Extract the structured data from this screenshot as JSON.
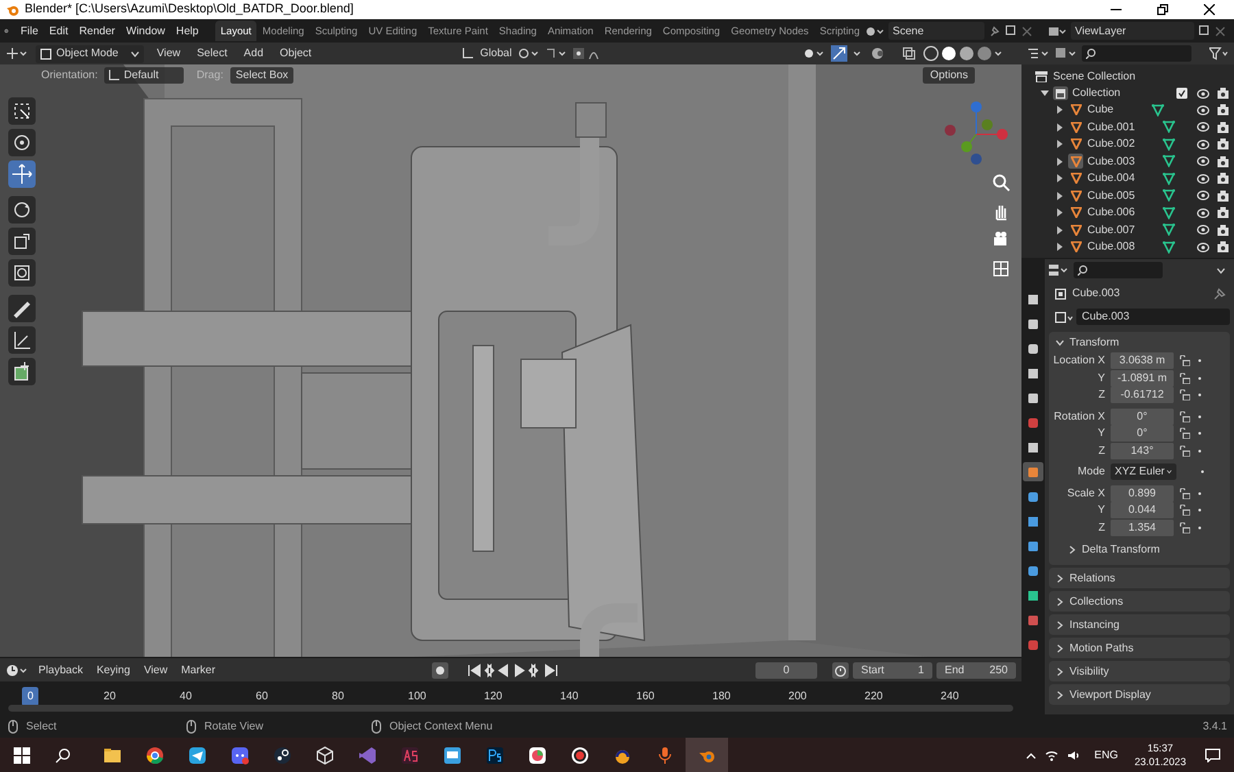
{
  "window": {
    "title": "Blender* [C:\\Users\\Azumi\\Desktop\\Old_BATDR_Door.blend]"
  },
  "menu": [
    "File",
    "Edit",
    "Render",
    "Window",
    "Help"
  ],
  "workspaces": [
    {
      "label": "Layout",
      "selected": true
    },
    {
      "label": "Modeling",
      "selected": false
    },
    {
      "label": "Sculpting",
      "selected": false
    },
    {
      "label": "UV Editing",
      "selected": false
    },
    {
      "label": "Texture Paint",
      "selected": false
    },
    {
      "label": "Shading",
      "selected": false
    },
    {
      "label": "Animation",
      "selected": false
    },
    {
      "label": "Rendering",
      "selected": false
    },
    {
      "label": "Compositing",
      "selected": false
    },
    {
      "label": "Geometry Nodes",
      "selected": false
    },
    {
      "label": "Scripting",
      "selected": false
    }
  ],
  "scene": "Scene",
  "view_layer": "ViewLayer",
  "viewport_header": {
    "mode": "Object Mode",
    "menus": [
      "View",
      "Select",
      "Add",
      "Object"
    ],
    "transform": "Global"
  },
  "tool_settings": {
    "orientation_label": "Orientation:",
    "orientation": "Default",
    "drag_label": "Drag:",
    "drag": "Select Box",
    "options": "Options"
  },
  "tools": [
    {
      "selected": false
    },
    {
      "selected": false
    },
    {
      "selected": true
    },
    {
      "selected": false
    },
    {
      "selected": false
    },
    {
      "selected": false
    },
    {
      "selected": false
    },
    {
      "selected": false
    },
    {
      "selected": false
    }
  ],
  "outliner": {
    "root": "Scene Collection",
    "collection": {
      "name": "Collection",
      "expanded": true,
      "checked": true,
      "children": [
        {
          "name": "Cube",
          "selected": false
        },
        {
          "name": "Cube.001",
          "selected": false
        },
        {
          "name": "Cube.002",
          "selected": false
        },
        {
          "name": "Cube.003",
          "selected": true
        },
        {
          "name": "Cube.004",
          "selected": false
        },
        {
          "name": "Cube.005",
          "selected": false
        },
        {
          "name": "Cube.006",
          "selected": false
        },
        {
          "name": "Cube.007",
          "selected": false
        },
        {
          "name": "Cube.008",
          "selected": false
        }
      ]
    }
  },
  "properties": {
    "object": "Cube.003",
    "object_field": "Cube.003",
    "tabs": [
      {
        "selected": false
      },
      {
        "selected": false
      },
      {
        "selected": false
      },
      {
        "selected": false
      },
      {
        "selected": false
      },
      {
        "selected": false
      },
      {
        "selected": false
      },
      {
        "selected": true
      },
      {
        "selected": false
      },
      {
        "selected": false
      },
      {
        "selected": false
      },
      {
        "selected": false
      },
      {
        "selected": false
      },
      {
        "selected": false
      },
      {
        "selected": false
      }
    ],
    "transform": {
      "title": "Transform",
      "expanded": true,
      "rows": [
        {
          "label": "Location X",
          "value": "3.0638 m"
        },
        {
          "label": "Y",
          "value": "-1.0891 m"
        },
        {
          "label": "Z",
          "value": "-0.61712"
        },
        {
          "label": "Rotation X",
          "value": "0°"
        },
        {
          "label": "Y",
          "value": "0°"
        },
        {
          "label": "Z",
          "value": "143°"
        },
        {
          "label": "Mode",
          "value": "XYZ Euler",
          "kind": "dropdown"
        },
        {
          "label": "Scale X",
          "value": "0.899"
        },
        {
          "label": "Y",
          "value": "0.044"
        },
        {
          "label": "Z",
          "value": "1.354"
        }
      ],
      "subpanel": "Delta Transform"
    },
    "panels": [
      "Relations",
      "Collections",
      "Instancing",
      "Motion Paths",
      "Visibility",
      "Viewport Display"
    ]
  },
  "timeline": {
    "menus": [
      "Playback",
      "Keying",
      "View",
      "Marker"
    ],
    "current_frame": "0",
    "start_label": "Start",
    "start": "1",
    "end_label": "End",
    "end": "250",
    "ticks": [
      {
        "label": "0",
        "selected": true
      },
      {
        "label": "20",
        "selected": false
      },
      {
        "label": "40",
        "selected": false
      },
      {
        "label": "60",
        "selected": false
      },
      {
        "label": "80",
        "selected": false
      },
      {
        "label": "100",
        "selected": false
      },
      {
        "label": "120",
        "selected": false
      },
      {
        "label": "140",
        "selected": false
      },
      {
        "label": "160",
        "selected": false
      },
      {
        "label": "180",
        "selected": false
      },
      {
        "label": "200",
        "selected": false
      },
      {
        "label": "220",
        "selected": false
      },
      {
        "label": "240",
        "selected": false
      }
    ]
  },
  "status_bar": {
    "hints": [
      "Select",
      "Rotate View",
      "Object Context Menu"
    ],
    "version": "3.4.1"
  },
  "taskbar": {
    "language": "ENG",
    "time": "15:37",
    "date": "23.01.2023"
  }
}
